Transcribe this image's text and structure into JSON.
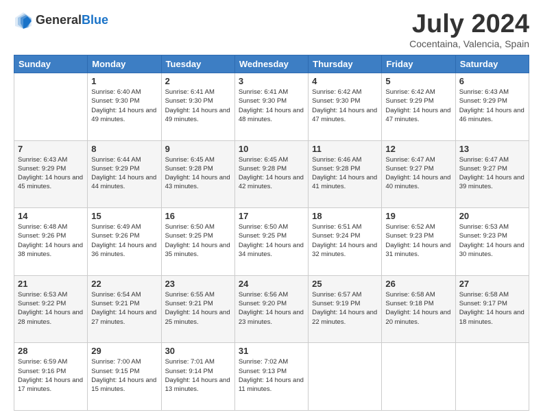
{
  "header": {
    "logo_general": "General",
    "logo_blue": "Blue",
    "main_title": "July 2024",
    "subtitle": "Cocentaina, Valencia, Spain"
  },
  "calendar": {
    "headers": [
      "Sunday",
      "Monday",
      "Tuesday",
      "Wednesday",
      "Thursday",
      "Friday",
      "Saturday"
    ],
    "weeks": [
      [
        {
          "day": "",
          "info": ""
        },
        {
          "day": "1",
          "info": "Sunrise: 6:40 AM\nSunset: 9:30 PM\nDaylight: 14 hours\nand 49 minutes."
        },
        {
          "day": "2",
          "info": "Sunrise: 6:41 AM\nSunset: 9:30 PM\nDaylight: 14 hours\nand 49 minutes."
        },
        {
          "day": "3",
          "info": "Sunrise: 6:41 AM\nSunset: 9:30 PM\nDaylight: 14 hours\nand 48 minutes."
        },
        {
          "day": "4",
          "info": "Sunrise: 6:42 AM\nSunset: 9:30 PM\nDaylight: 14 hours\nand 47 minutes."
        },
        {
          "day": "5",
          "info": "Sunrise: 6:42 AM\nSunset: 9:29 PM\nDaylight: 14 hours\nand 47 minutes."
        },
        {
          "day": "6",
          "info": "Sunrise: 6:43 AM\nSunset: 9:29 PM\nDaylight: 14 hours\nand 46 minutes."
        }
      ],
      [
        {
          "day": "7",
          "info": "Sunrise: 6:43 AM\nSunset: 9:29 PM\nDaylight: 14 hours\nand 45 minutes."
        },
        {
          "day": "8",
          "info": "Sunrise: 6:44 AM\nSunset: 9:29 PM\nDaylight: 14 hours\nand 44 minutes."
        },
        {
          "day": "9",
          "info": "Sunrise: 6:45 AM\nSunset: 9:28 PM\nDaylight: 14 hours\nand 43 minutes."
        },
        {
          "day": "10",
          "info": "Sunrise: 6:45 AM\nSunset: 9:28 PM\nDaylight: 14 hours\nand 42 minutes."
        },
        {
          "day": "11",
          "info": "Sunrise: 6:46 AM\nSunset: 9:28 PM\nDaylight: 14 hours\nand 41 minutes."
        },
        {
          "day": "12",
          "info": "Sunrise: 6:47 AM\nSunset: 9:27 PM\nDaylight: 14 hours\nand 40 minutes."
        },
        {
          "day": "13",
          "info": "Sunrise: 6:47 AM\nSunset: 9:27 PM\nDaylight: 14 hours\nand 39 minutes."
        }
      ],
      [
        {
          "day": "14",
          "info": "Sunrise: 6:48 AM\nSunset: 9:26 PM\nDaylight: 14 hours\nand 38 minutes."
        },
        {
          "day": "15",
          "info": "Sunrise: 6:49 AM\nSunset: 9:26 PM\nDaylight: 14 hours\nand 36 minutes."
        },
        {
          "day": "16",
          "info": "Sunrise: 6:50 AM\nSunset: 9:25 PM\nDaylight: 14 hours\nand 35 minutes."
        },
        {
          "day": "17",
          "info": "Sunrise: 6:50 AM\nSunset: 9:25 PM\nDaylight: 14 hours\nand 34 minutes."
        },
        {
          "day": "18",
          "info": "Sunrise: 6:51 AM\nSunset: 9:24 PM\nDaylight: 14 hours\nand 32 minutes."
        },
        {
          "day": "19",
          "info": "Sunrise: 6:52 AM\nSunset: 9:23 PM\nDaylight: 14 hours\nand 31 minutes."
        },
        {
          "day": "20",
          "info": "Sunrise: 6:53 AM\nSunset: 9:23 PM\nDaylight: 14 hours\nand 30 minutes."
        }
      ],
      [
        {
          "day": "21",
          "info": "Sunrise: 6:53 AM\nSunset: 9:22 PM\nDaylight: 14 hours\nand 28 minutes."
        },
        {
          "day": "22",
          "info": "Sunrise: 6:54 AM\nSunset: 9:21 PM\nDaylight: 14 hours\nand 27 minutes."
        },
        {
          "day": "23",
          "info": "Sunrise: 6:55 AM\nSunset: 9:21 PM\nDaylight: 14 hours\nand 25 minutes."
        },
        {
          "day": "24",
          "info": "Sunrise: 6:56 AM\nSunset: 9:20 PM\nDaylight: 14 hours\nand 23 minutes."
        },
        {
          "day": "25",
          "info": "Sunrise: 6:57 AM\nSunset: 9:19 PM\nDaylight: 14 hours\nand 22 minutes."
        },
        {
          "day": "26",
          "info": "Sunrise: 6:58 AM\nSunset: 9:18 PM\nDaylight: 14 hours\nand 20 minutes."
        },
        {
          "day": "27",
          "info": "Sunrise: 6:58 AM\nSunset: 9:17 PM\nDaylight: 14 hours\nand 18 minutes."
        }
      ],
      [
        {
          "day": "28",
          "info": "Sunrise: 6:59 AM\nSunset: 9:16 PM\nDaylight: 14 hours\nand 17 minutes."
        },
        {
          "day": "29",
          "info": "Sunrise: 7:00 AM\nSunset: 9:15 PM\nDaylight: 14 hours\nand 15 minutes."
        },
        {
          "day": "30",
          "info": "Sunrise: 7:01 AM\nSunset: 9:14 PM\nDaylight: 14 hours\nand 13 minutes."
        },
        {
          "day": "31",
          "info": "Sunrise: 7:02 AM\nSunset: 9:13 PM\nDaylight: 14 hours\nand 11 minutes."
        },
        {
          "day": "",
          "info": ""
        },
        {
          "day": "",
          "info": ""
        },
        {
          "day": "",
          "info": ""
        }
      ]
    ]
  }
}
